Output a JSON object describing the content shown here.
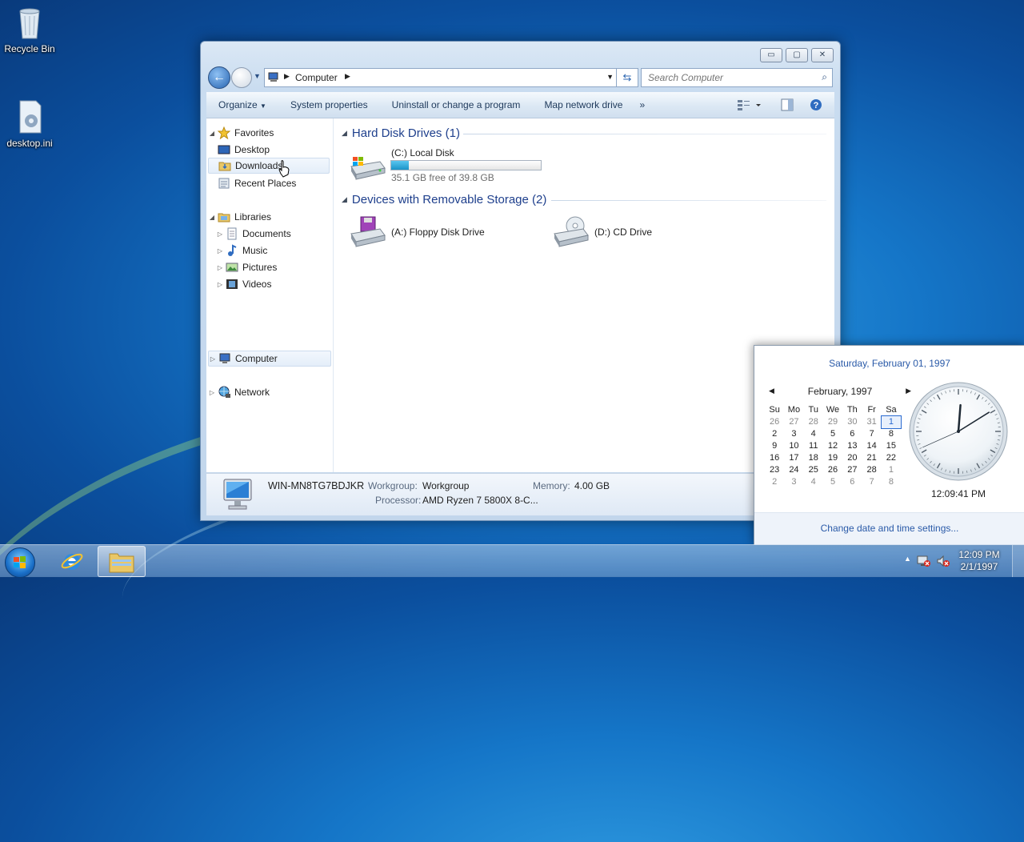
{
  "desktop": {
    "icons": [
      {
        "label": "Recycle Bin",
        "icon": "recycle-bin-icon"
      },
      {
        "label": "desktop.ini",
        "icon": "settings-file-icon"
      }
    ]
  },
  "window": {
    "address": {
      "crumb": "Computer"
    },
    "search": {
      "placeholder": "Search Computer"
    },
    "toolbar": {
      "organize": "Organize",
      "system_properties": "System properties",
      "uninstall": "Uninstall or change a program",
      "map_drive": "Map network drive",
      "more": "»"
    },
    "nav": {
      "favorites": "Favorites",
      "desktop": "Desktop",
      "downloads": "Downloads",
      "recent": "Recent Places",
      "libraries": "Libraries",
      "documents": "Documents",
      "music": "Music",
      "pictures": "Pictures",
      "videos": "Videos",
      "computer": "Computer",
      "network": "Network"
    },
    "groups": {
      "hdd": "Hard Disk Drives (1)",
      "removable": "Devices with Removable Storage (2)"
    },
    "drives": {
      "c": {
        "name": "(C:) Local Disk",
        "free": "35.1 GB free of 39.8 GB",
        "used_fraction": 0.118
      },
      "a": {
        "name": "(A:) Floppy Disk Drive"
      },
      "d": {
        "name": "(D:) CD Drive"
      }
    },
    "details": {
      "computer_name": "WIN-MN8TG7BDJKR",
      "workgroup_label": "Workgroup:",
      "workgroup": "Workgroup",
      "memory_label": "Memory:",
      "memory": "4.00 GB",
      "processor_label": "Processor:",
      "processor": "AMD Ryzen 7 5800X 8-C..."
    }
  },
  "calendar": {
    "full_date": "Saturday, February 01, 1997",
    "month": "February, 1997",
    "weekdays": [
      "Su",
      "Mo",
      "Tu",
      "We",
      "Th",
      "Fr",
      "Sa"
    ],
    "days": [
      [
        "26",
        "27",
        "28",
        "29",
        "30",
        "31",
        "1"
      ],
      [
        "2",
        "3",
        "4",
        "5",
        "6",
        "7",
        "8"
      ],
      [
        "9",
        "10",
        "11",
        "12",
        "13",
        "14",
        "15"
      ],
      [
        "16",
        "17",
        "18",
        "19",
        "20",
        "21",
        "22"
      ],
      [
        "23",
        "24",
        "25",
        "26",
        "27",
        "28",
        "1"
      ],
      [
        "2",
        "3",
        "4",
        "5",
        "6",
        "7",
        "8"
      ]
    ],
    "time": "12:09:41 PM",
    "change_link": "Change date and time settings..."
  },
  "taskbar": {
    "time": "12:09 PM",
    "date": "2/1/1997"
  }
}
